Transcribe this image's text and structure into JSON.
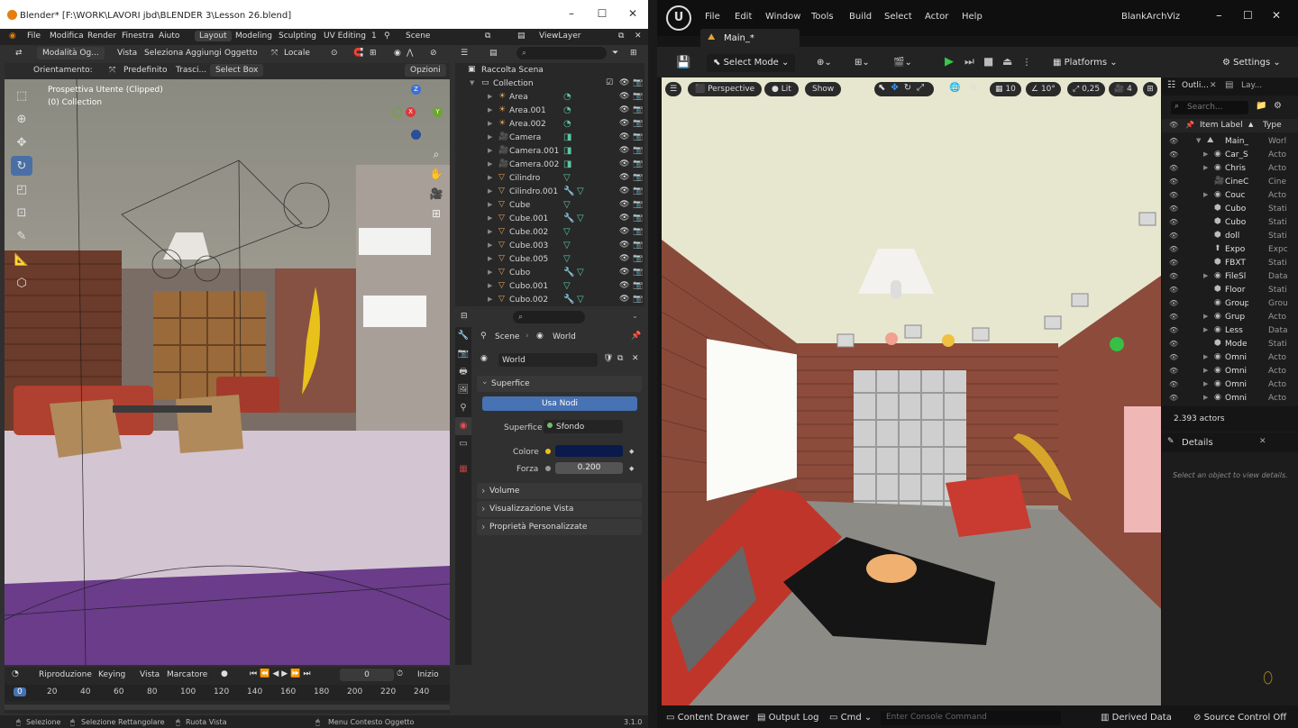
{
  "blender": {
    "window_title": "Blender* [F:\\WORK\\LAVORI jbd\\BLENDER 3\\Lesson 26.blend]",
    "menu": [
      "File",
      "Modifica",
      "Render",
      "Finestra",
      "Aiuto"
    ],
    "workspaces": [
      "Layout",
      "Modeling",
      "Sculpting",
      "UV Editing"
    ],
    "workspace_more": "1",
    "scene_name": "Scene",
    "view_layer": "ViewLayer",
    "viewport_header": {
      "mode": "Modalità Og...",
      "menus": [
        "Vista",
        "Seleziona",
        "Aggiungi",
        "Oggetto"
      ],
      "transform_orientation": "Locale",
      "orientation_label": "Orientamento:",
      "orientation_value": "Predefinito",
      "drag_label": "Trasci...",
      "drag_value": "Select Box",
      "options": "Opzioni"
    },
    "viewport_overlay": {
      "line1": "Prospettiva Utente (Clipped)",
      "line2": "(0) Collection"
    },
    "gizmo_axes": [
      "Z",
      "X",
      "Y"
    ],
    "outliner": {
      "root": "Raccolta Scena",
      "collection": "Collection",
      "items": [
        {
          "name": "Area",
          "icon": "light-icon",
          "modifier": false
        },
        {
          "name": "Area.001",
          "icon": "light-icon",
          "modifier": false
        },
        {
          "name": "Area.002",
          "icon": "light-icon",
          "modifier": false
        },
        {
          "name": "Camera",
          "icon": "camera-icon",
          "modifier": false
        },
        {
          "name": "Camera.001",
          "icon": "camera-icon",
          "modifier": false
        },
        {
          "name": "Camera.002",
          "icon": "camera-icon",
          "modifier": false
        },
        {
          "name": "Cilindro",
          "icon": "mesh-icon",
          "modifier": false
        },
        {
          "name": "Cilindro.001",
          "icon": "mesh-icon",
          "modifier": true
        },
        {
          "name": "Cube",
          "icon": "mesh-icon",
          "modifier": false
        },
        {
          "name": "Cube.001",
          "icon": "mesh-icon",
          "modifier": true
        },
        {
          "name": "Cube.002",
          "icon": "mesh-icon",
          "modifier": false
        },
        {
          "name": "Cube.003",
          "icon": "mesh-icon",
          "modifier": false
        },
        {
          "name": "Cube.005",
          "icon": "mesh-icon",
          "modifier": false
        },
        {
          "name": "Cubo",
          "icon": "mesh-icon",
          "modifier": true
        },
        {
          "name": "Cubo.001",
          "icon": "mesh-icon",
          "modifier": false
        },
        {
          "name": "Cubo.002",
          "icon": "mesh-icon",
          "modifier": true
        }
      ]
    },
    "properties": {
      "breadcrumb": [
        "Scene",
        "World"
      ],
      "world_name": "World",
      "surface_panel": "Superfice",
      "use_nodes": "Usa Nodi",
      "surface_label": "Superfice",
      "surface_value": "Sfondo",
      "color_label": "Colore",
      "color_value": "#0a1a4a",
      "strength_label": "Forza",
      "strength_value": "0.200",
      "collapsed_panels": [
        "Volume",
        "Visualizzazione Vista",
        "Proprietà Personalizzate"
      ]
    },
    "timeline": {
      "menus": [
        "Riproduzione",
        "Keying",
        "Vista",
        "Marcatore"
      ],
      "current_frame": "0",
      "start_label": "Inizio",
      "ticks": [
        "0",
        "20",
        "40",
        "60",
        "80",
        "100",
        "120",
        "140",
        "160",
        "180",
        "200",
        "220",
        "240"
      ]
    },
    "status_bar": {
      "items": [
        "Selezione",
        "Selezione Rettangolare",
        "Ruota Vista",
        "Menu Contesto Oggetto"
      ],
      "version": "3.1.0"
    }
  },
  "unreal": {
    "menu": [
      "File",
      "Edit",
      "Window",
      "Tools",
      "Build",
      "Select",
      "Actor",
      "Help"
    ],
    "project_name": "BlankArchViz",
    "level_tab": "Main_*",
    "toolbar": {
      "select_mode": "Select Mode",
      "platforms": "Platforms",
      "settings": "Settings"
    },
    "viewport": {
      "perspective": "Perspective",
      "lit": "Lit",
      "show": "Show",
      "grid_snap": "10",
      "rotation_snap": "10°",
      "scale_snap": "0,25",
      "camera_speed": "4"
    },
    "outliner": {
      "tab": "Outli...",
      "tab2": "Lay...",
      "search_placeholder": "Search...",
      "col_label": "Item Label",
      "col_type": "Type",
      "rows": [
        {
          "label": "Main_(",
          "type": "Worl",
          "icon": "level-icon",
          "expand": true
        },
        {
          "label": "Car_S",
          "type": "Acto",
          "icon": "actor-icon",
          "expand": true
        },
        {
          "label": "Chris",
          "type": "Acto",
          "icon": "actor-icon",
          "expand": true
        },
        {
          "label": "CineC",
          "type": "Cine",
          "icon": "cinecamera-icon",
          "expand": false
        },
        {
          "label": "Couc",
          "type": "Acto",
          "icon": "actor-icon",
          "expand": true
        },
        {
          "label": "Cubo",
          "type": "Stati",
          "icon": "staticmesh-icon",
          "expand": false
        },
        {
          "label": "Cubo",
          "type": "Stati",
          "icon": "staticmesh-icon",
          "expand": false
        },
        {
          "label": "doll",
          "type": "Stati",
          "icon": "staticmesh-icon",
          "expand": false
        },
        {
          "label": "Expo",
          "type": "Expc",
          "icon": "export-icon",
          "expand": false
        },
        {
          "label": "FBXT",
          "type": "Stati",
          "icon": "staticmesh-icon",
          "expand": false
        },
        {
          "label": "FileSl",
          "type": "Data",
          "icon": "data-icon",
          "expand": true
        },
        {
          "label": "Floor",
          "type": "Stati",
          "icon": "staticmesh-icon",
          "expand": false
        },
        {
          "label": "Group",
          "type": "Grou",
          "icon": "group-icon",
          "expand": false
        },
        {
          "label": "Grup",
          "type": "Acto",
          "icon": "actor-icon",
          "expand": true
        },
        {
          "label": "Less",
          "type": "Data",
          "icon": "data-icon",
          "expand": true
        },
        {
          "label": "Mode",
          "type": "Stati",
          "icon": "staticmesh-icon",
          "expand": false
        },
        {
          "label": "Omni",
          "type": "Acto",
          "icon": "actor-icon",
          "expand": true
        },
        {
          "label": "Omni",
          "type": "Acto",
          "icon": "actor-icon",
          "expand": true
        },
        {
          "label": "Omni",
          "type": "Acto",
          "icon": "actor-icon",
          "expand": true
        },
        {
          "label": "Omni",
          "type": "Acto",
          "icon": "actor-icon",
          "expand": true
        }
      ],
      "actor_count": "2.393 actors"
    },
    "details": {
      "title": "Details",
      "empty_msg": "Select an object to view details."
    },
    "bottom_bar": {
      "content_drawer": "Content Drawer",
      "output_log": "Output Log",
      "cmd": "Cmd",
      "console_placeholder": "Enter Console Command",
      "derived_data": "Derived Data",
      "source_control": "Source Control Off"
    }
  }
}
